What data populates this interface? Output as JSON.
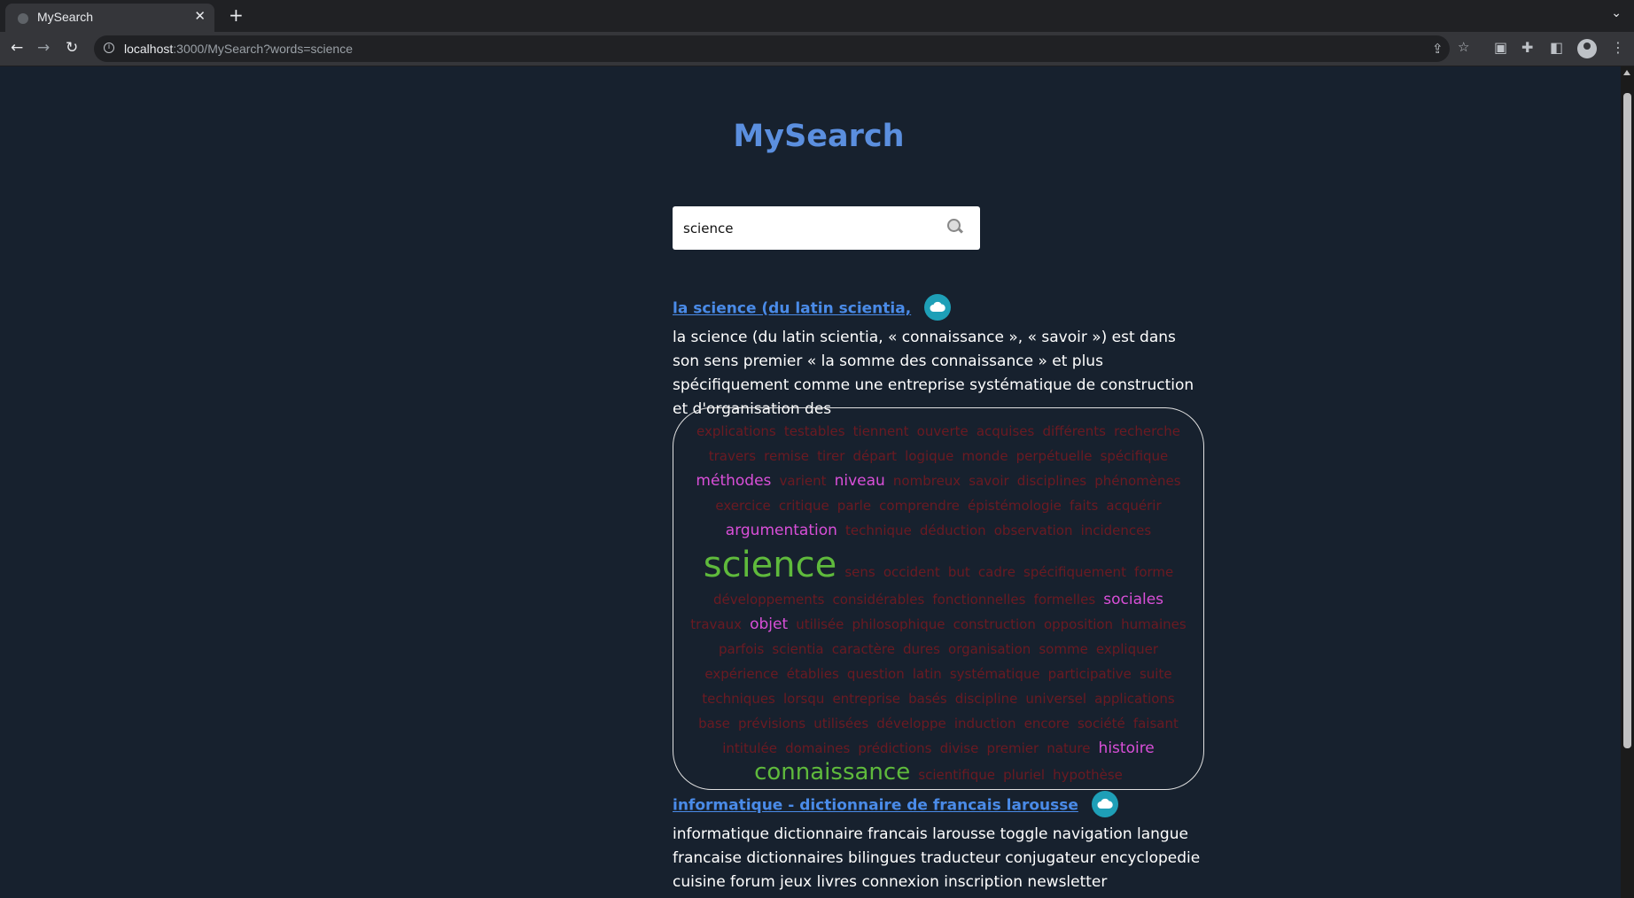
{
  "browser": {
    "tab_title": "MySearch",
    "tab_close": "✕",
    "new_tab": "+",
    "url_host": "localhost",
    "url_rest": ":3000/MySearch?words=science"
  },
  "page": {
    "title": "MySearch",
    "search_value": "science"
  },
  "results": [
    {
      "title": "la science (du latin scientia,",
      "snippet": "la science (du latin scientia, « connaissance », « savoir ») est dans son sens premier « la somme des connaissance » et plus spécifiquement comme une entreprise systématique de construction et d'organisation des"
    },
    {
      "title": "informatique - dictionnaire de francais larousse",
      "snippet": "informatique dictionnaire francais larousse toggle navigation langue francaise dictionnaires bilingues traducteur conjugateur encyclopedie cuisine forum jeux livres connexion inscription newsletter"
    }
  ],
  "wordcloud": [
    {
      "t": "explications",
      "s": "small"
    },
    {
      "t": "testables",
      "s": "small"
    },
    {
      "t": "tiennent",
      "s": "small"
    },
    {
      "t": "ouverte",
      "s": "small"
    },
    {
      "t": "acquises",
      "s": "small"
    },
    {
      "t": "différents",
      "s": "small"
    },
    {
      "t": "recherche",
      "s": "small"
    },
    {
      "t": "travers",
      "s": "small"
    },
    {
      "t": "remise",
      "s": "small"
    },
    {
      "t": "tirer",
      "s": "small"
    },
    {
      "t": "départ",
      "s": "small"
    },
    {
      "t": "logique",
      "s": "small"
    },
    {
      "t": "monde",
      "s": "small"
    },
    {
      "t": "perpétuelle",
      "s": "small"
    },
    {
      "t": "spécifique",
      "s": "small"
    },
    {
      "t": "méthodes",
      "s": "med"
    },
    {
      "t": "varient",
      "s": "small"
    },
    {
      "t": "niveau",
      "s": "med"
    },
    {
      "t": "nombreux",
      "s": "small"
    },
    {
      "t": "savoir",
      "s": "small"
    },
    {
      "t": "disciplines",
      "s": "small"
    },
    {
      "t": "phénomènes",
      "s": "small"
    },
    {
      "t": "exercice",
      "s": "small"
    },
    {
      "t": "critique",
      "s": "small"
    },
    {
      "t": "parle",
      "s": "small"
    },
    {
      "t": "comprendre",
      "s": "small"
    },
    {
      "t": "épistémologie",
      "s": "small"
    },
    {
      "t": "faits",
      "s": "small"
    },
    {
      "t": "acquérir",
      "s": "small"
    },
    {
      "t": "argumentation",
      "s": "med"
    },
    {
      "t": "technique",
      "s": "small"
    },
    {
      "t": "déduction",
      "s": "small"
    },
    {
      "t": "observation",
      "s": "small"
    },
    {
      "t": "incidences",
      "s": "small"
    },
    {
      "t": "science",
      "s": "huge"
    },
    {
      "t": "sens",
      "s": "small"
    },
    {
      "t": "occident",
      "s": "small"
    },
    {
      "t": "but",
      "s": "small"
    },
    {
      "t": "cadre",
      "s": "small"
    },
    {
      "t": "spécifiquement",
      "s": "small"
    },
    {
      "t": "forme",
      "s": "small"
    },
    {
      "t": "développements",
      "s": "small"
    },
    {
      "t": "considérables",
      "s": "small"
    },
    {
      "t": "fonctionnelles",
      "s": "small"
    },
    {
      "t": "formelles",
      "s": "small"
    },
    {
      "t": "sociales",
      "s": "med"
    },
    {
      "t": "travaux",
      "s": "small"
    },
    {
      "t": "objet",
      "s": "med"
    },
    {
      "t": "utilisée",
      "s": "small"
    },
    {
      "t": "philosophique",
      "s": "small"
    },
    {
      "t": "construction",
      "s": "small"
    },
    {
      "t": "opposition",
      "s": "small"
    },
    {
      "t": "humaines",
      "s": "small"
    },
    {
      "t": "parfois",
      "s": "small"
    },
    {
      "t": "scientia",
      "s": "small"
    },
    {
      "t": "caractère",
      "s": "small"
    },
    {
      "t": "dures",
      "s": "small"
    },
    {
      "t": "organisation",
      "s": "small"
    },
    {
      "t": "somme",
      "s": "small"
    },
    {
      "t": "expliquer",
      "s": "small"
    },
    {
      "t": "expérience",
      "s": "small"
    },
    {
      "t": "établies",
      "s": "small"
    },
    {
      "t": "question",
      "s": "small"
    },
    {
      "t": "latin",
      "s": "small"
    },
    {
      "t": "systématique",
      "s": "small"
    },
    {
      "t": "participative",
      "s": "small"
    },
    {
      "t": "suite",
      "s": "small"
    },
    {
      "t": "techniques",
      "s": "small"
    },
    {
      "t": "lorsqu",
      "s": "small"
    },
    {
      "t": "entreprise",
      "s": "small"
    },
    {
      "t": "basés",
      "s": "small"
    },
    {
      "t": "discipline",
      "s": "small"
    },
    {
      "t": "universel",
      "s": "small"
    },
    {
      "t": "applications",
      "s": "small"
    },
    {
      "t": "base",
      "s": "small"
    },
    {
      "t": "prévisions",
      "s": "small"
    },
    {
      "t": "utilisées",
      "s": "small"
    },
    {
      "t": "développe",
      "s": "small"
    },
    {
      "t": "induction",
      "s": "small"
    },
    {
      "t": "encore",
      "s": "small"
    },
    {
      "t": "société",
      "s": "small"
    },
    {
      "t": "faisant",
      "s": "small"
    },
    {
      "t": "intitulée",
      "s": "small"
    },
    {
      "t": "domaines",
      "s": "small"
    },
    {
      "t": "prédictions",
      "s": "small"
    },
    {
      "t": "divise",
      "s": "small"
    },
    {
      "t": "premier",
      "s": "small"
    },
    {
      "t": "nature",
      "s": "small"
    },
    {
      "t": "histoire",
      "s": "med"
    },
    {
      "t": "connaissance",
      "s": "big"
    },
    {
      "t": "scientifique",
      "s": "small"
    },
    {
      "t": "pluriel",
      "s": "small"
    },
    {
      "t": "hypothèse",
      "s": "small"
    }
  ],
  "colors": {
    "background": "#17212e",
    "title": "#5b8fdf",
    "link": "#4a8be8",
    "cloud_button": "#1e9fb7",
    "word_small": "#6b1a22",
    "word_medium": "#d94fd8",
    "word_large": "#5fba3c"
  }
}
